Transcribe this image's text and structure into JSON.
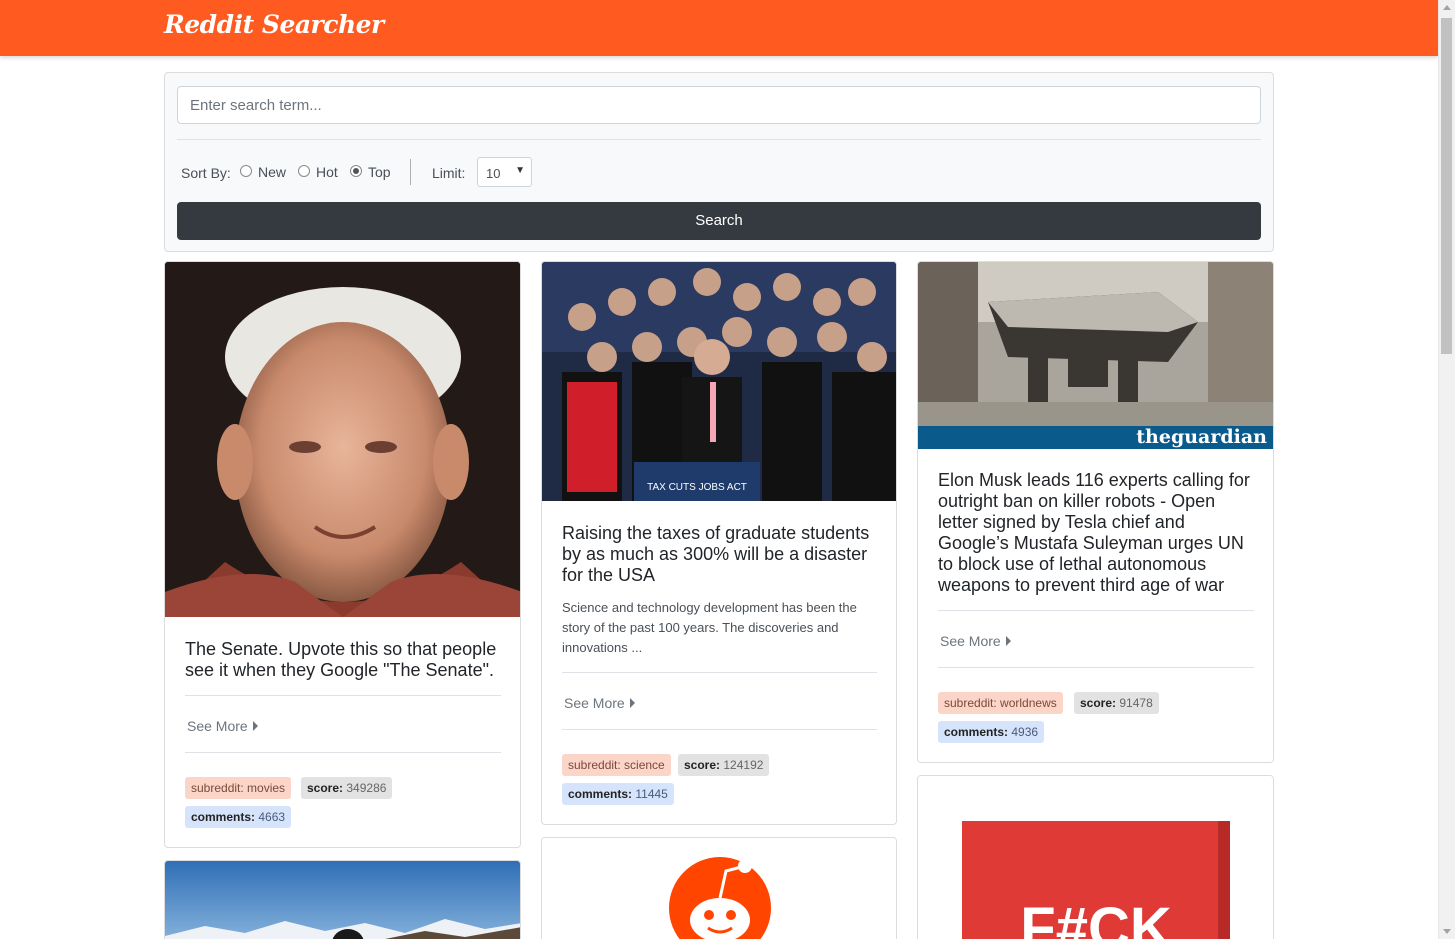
{
  "header": {
    "brand": "Reddit Searcher"
  },
  "search": {
    "placeholder": "Enter search term...",
    "sort_label": "Sort By:",
    "sort_options": [
      "New",
      "Hot",
      "Top"
    ],
    "sort_selected": "Top",
    "limit_label": "Limit:",
    "limit_value": "10",
    "button_label": "Search"
  },
  "cards": [
    {
      "title": "The Senate. Upvote this so that people see it when they Google \"The Senate\".",
      "text": "",
      "see_more": "See More",
      "subreddit_label": "subreddit:",
      "subreddit": "movies",
      "score_label": "score:",
      "score": "349286",
      "comments_label": "comments:",
      "comments": "4663"
    },
    {
      "title": "Raising the taxes of graduate students by as much as 300% will be a disaster for the USA",
      "text": "Science and technology development has been the story of the past 100 years. The discoveries and innovations ...",
      "image_caption": "TAX CUTS JOBS ACT",
      "see_more": "See More",
      "subreddit_label": "subreddit:",
      "subreddit": "science",
      "score_label": "score:",
      "score": "124192",
      "comments_label": "comments:",
      "comments": "11445"
    },
    {
      "title": "Elon Musk leads 116 experts calling for outright ban on killer robots - Open letter signed by Tesla chief and Google’s Mustafa Suleyman urges UN to block use of lethal autonomous weapons to prevent third age of war",
      "text": "",
      "image_caption": "theguardian",
      "see_more": "See More",
      "subreddit_label": "subreddit:",
      "subreddit": "worldnews",
      "score_label": "score:",
      "score": "91478",
      "comments_label": "comments:",
      "comments": "4936"
    }
  ],
  "partial_cards": {
    "fourth_image_text": "F#CK"
  },
  "colors": {
    "brand": "#ff5a1f",
    "button": "#343a40"
  }
}
